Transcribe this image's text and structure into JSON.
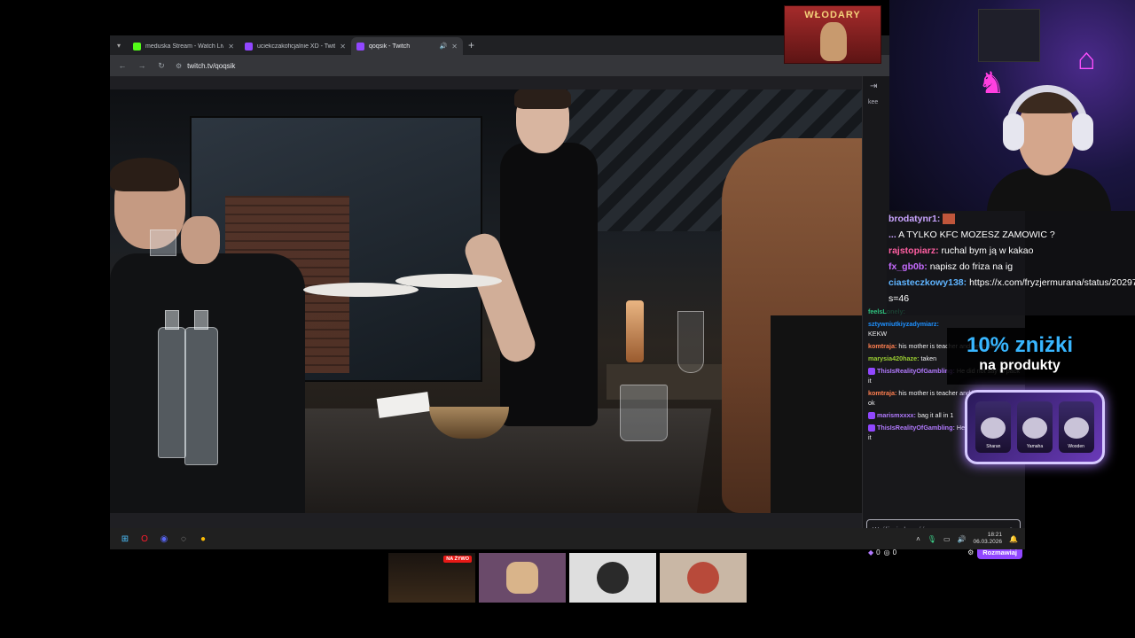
{
  "browser": {
    "tabs": [
      {
        "title": "meduska Stream - Watch Live o",
        "icon_color": "#53fc18",
        "active": false
      },
      {
        "title": "uciekczakoficjalnie XD - Twitch",
        "icon_color": "#9147ff",
        "active": false
      },
      {
        "title": "qoqsik - Twitch",
        "icon_color": "#9147ff",
        "active": true
      }
    ],
    "url": "twitch.tv/qoqsik"
  },
  "chat": {
    "input_placeholder": "Wyślij wiadomość",
    "points_a": "0",
    "points_b": "0",
    "chat_button": "Rozmawiaj",
    "pinned_text": "kee",
    "messages": [
      {
        "user": "feelsLonely:",
        "text": "",
        "color": "#2ec27e"
      },
      {
        "user": "sztywniutkiyzadymiarz:",
        "text": "KEKW",
        "color": "#1e90ff"
      },
      {
        "user": "komtraja:",
        "text": "his mother is teacher and he is funny",
        "color": "#ff7f50"
      },
      {
        "user": "marysia420haze:",
        "text": "taken",
        "color": "#9acd32"
      },
      {
        "user": "ThisIsRealityOfGambling:",
        "text": "He did not say to pack it",
        "color": "#b27aff"
      },
      {
        "user": "komtraja:",
        "text": "his mother is teacher and he is funny guy ok",
        "color": "#ff7f50"
      },
      {
        "user": "marismxxxx:",
        "text": "bag it all in 1",
        "color": "#b27aff"
      },
      {
        "user": "ThisIsRealityOfGambling:",
        "text": "He did not say to pack it",
        "color": "#b27aff"
      }
    ]
  },
  "overlay_chat": [
    {
      "user": "brodatynr1:",
      "text": "",
      "color": "#c9a4ff"
    },
    {
      "user": "...",
      "text": "A TYLKO KFC MOZESZ ZAMOWIC ?",
      "color": "#c9a4ff"
    },
    {
      "user": "rajstopiarz:",
      "text": "ruchal bym ją w kakao",
      "color": "#ff5fa2"
    },
    {
      "user": "fx_gb0b:",
      "text": "napisz do friza na ig",
      "color": "#c66bff"
    },
    {
      "user": "ciasteczkowy138:",
      "text": "https://x.com/fryzjermurana/status/20297",
      "color": "#5fb4ff"
    },
    {
      "user": "",
      "text": "s=46",
      "color": "#ffffff"
    }
  ],
  "taskbar": {
    "time": "18:21",
    "date": "06.03.2026"
  },
  "logo": {
    "text": "WŁODARY"
  },
  "ad": {
    "line1": "10% zniżki",
    "line2": "na produkty",
    "cards": [
      "Sharan",
      "Yamaha",
      "Wooden"
    ]
  },
  "participants": [
    {
      "live_label": "NA ŻYWO"
    }
  ],
  "colors": {
    "twitch_purple": "#9147ff",
    "chat_bg": "#18181b",
    "ad_blue": "#38b6ff"
  }
}
